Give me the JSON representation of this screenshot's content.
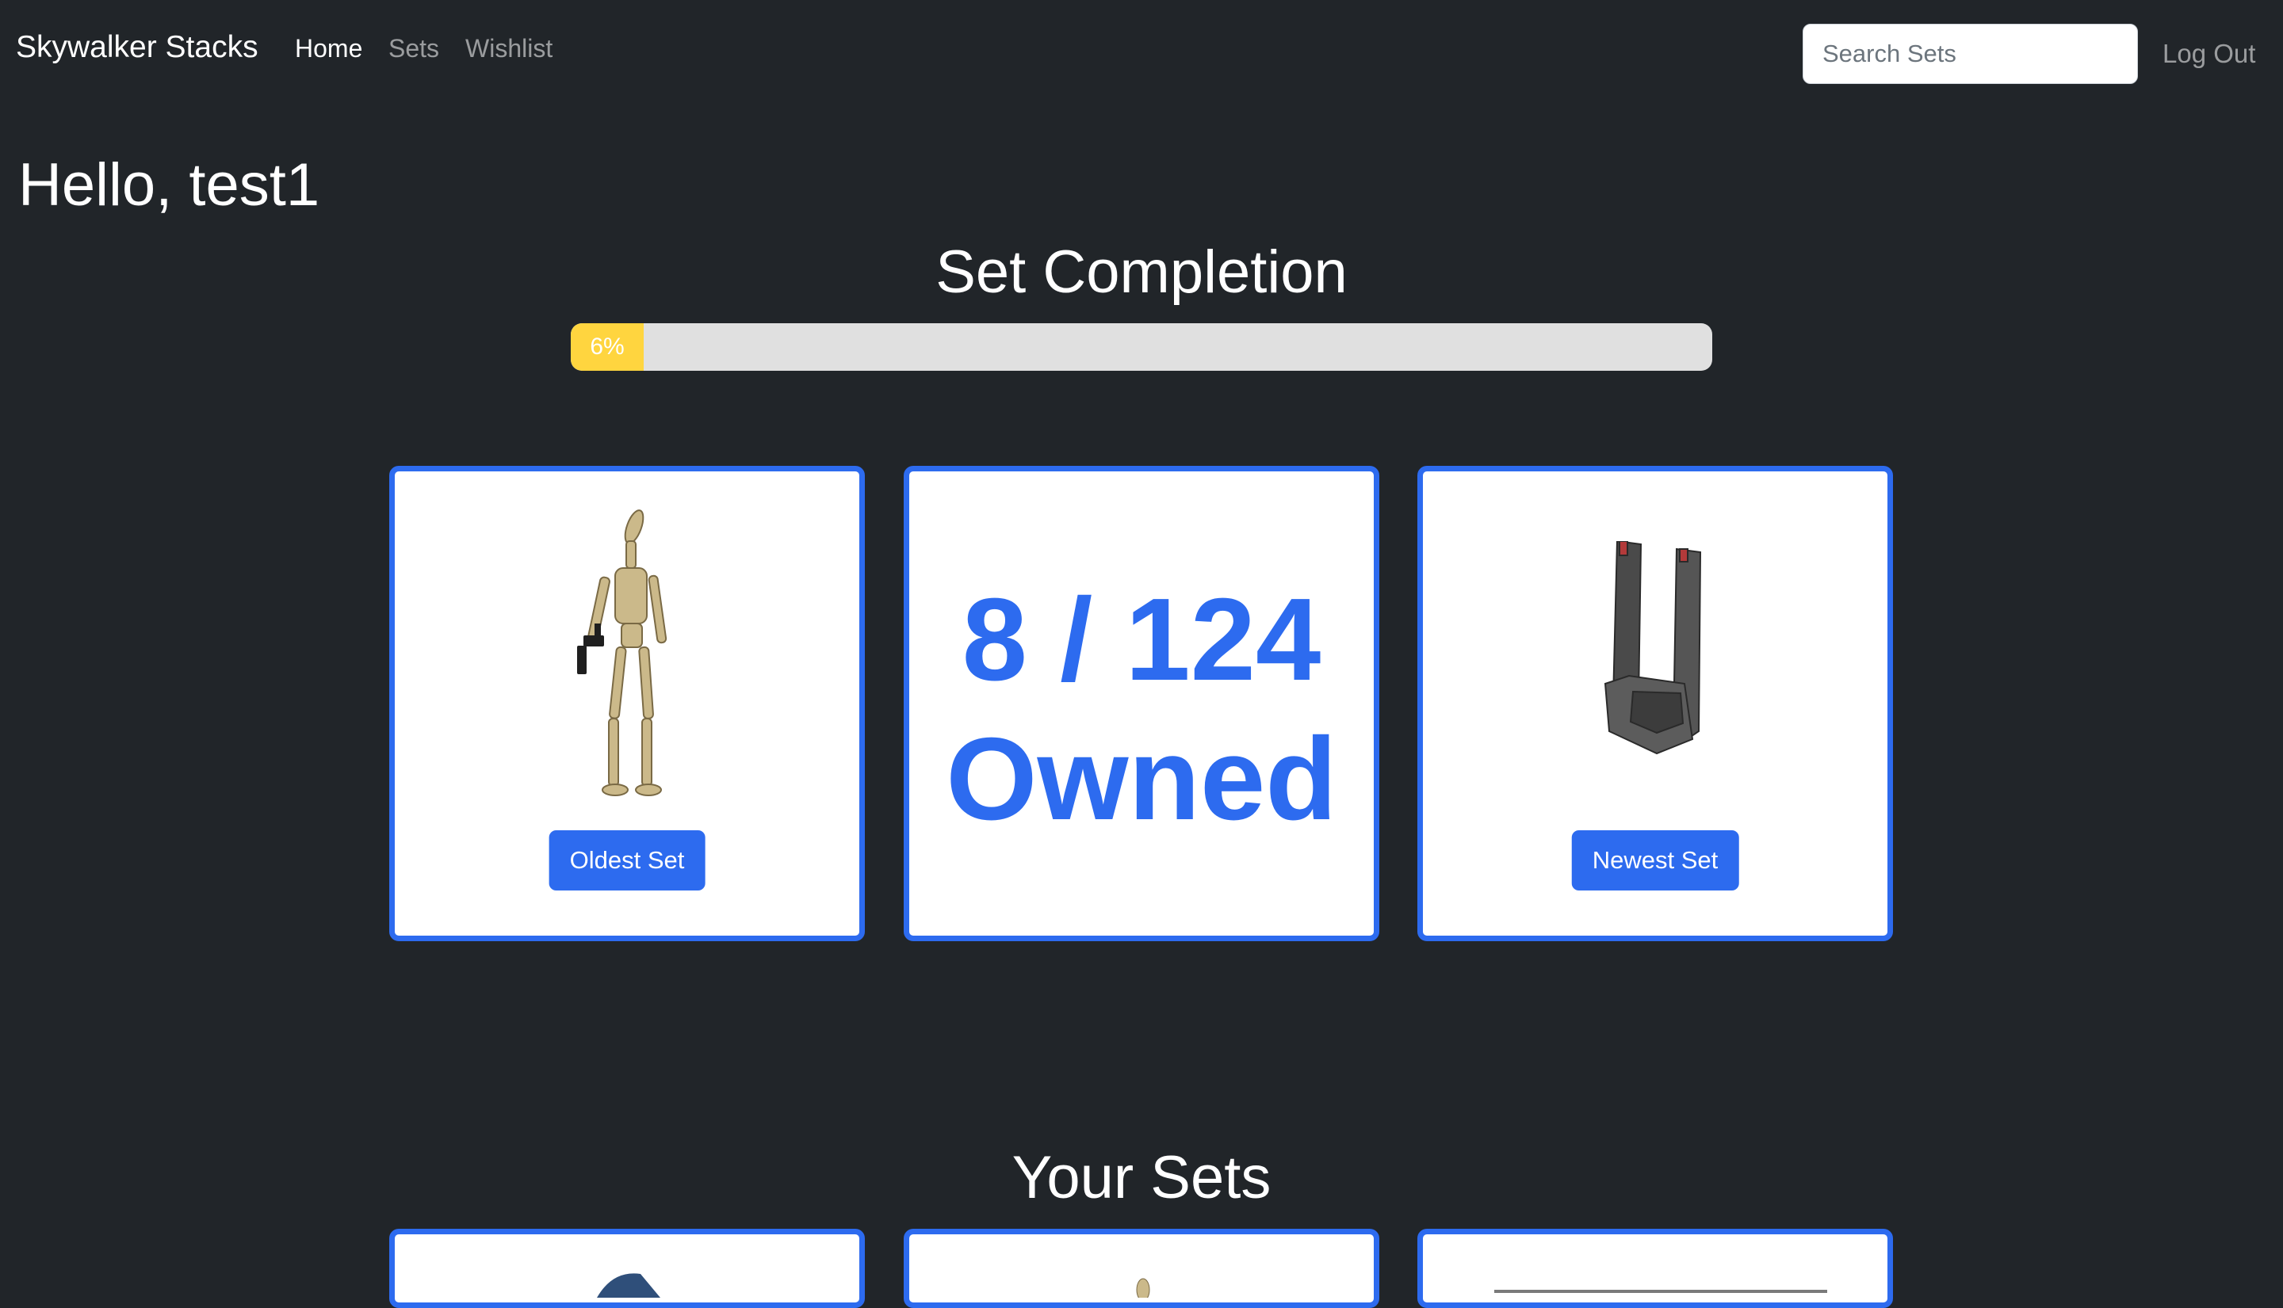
{
  "nav": {
    "brand": "Skywalker Stacks",
    "links": [
      {
        "label": "Home",
        "active": true
      },
      {
        "label": "Sets",
        "active": false
      },
      {
        "label": "Wishlist",
        "active": false
      }
    ],
    "search_placeholder": "Search Sets",
    "logout": "Log Out"
  },
  "greeting": "Hello, test1",
  "completion": {
    "title": "Set Completion",
    "percent": 6,
    "percent_label": "6%"
  },
  "cards": {
    "oldest": {
      "button": "Oldest Set",
      "image_icon": "battle-droid-figure-icon"
    },
    "owned": {
      "line1": "8 / 124",
      "line2": "Owned"
    },
    "newest": {
      "button": "Newest Set",
      "image_icon": "command-shuttle-model-icon"
    }
  },
  "your_sets_title": "Your Sets",
  "colors": {
    "background": "#212529",
    "accent": "#2d6bef",
    "progress_fill": "#ffd53f",
    "progress_track": "#e0e0e0"
  }
}
